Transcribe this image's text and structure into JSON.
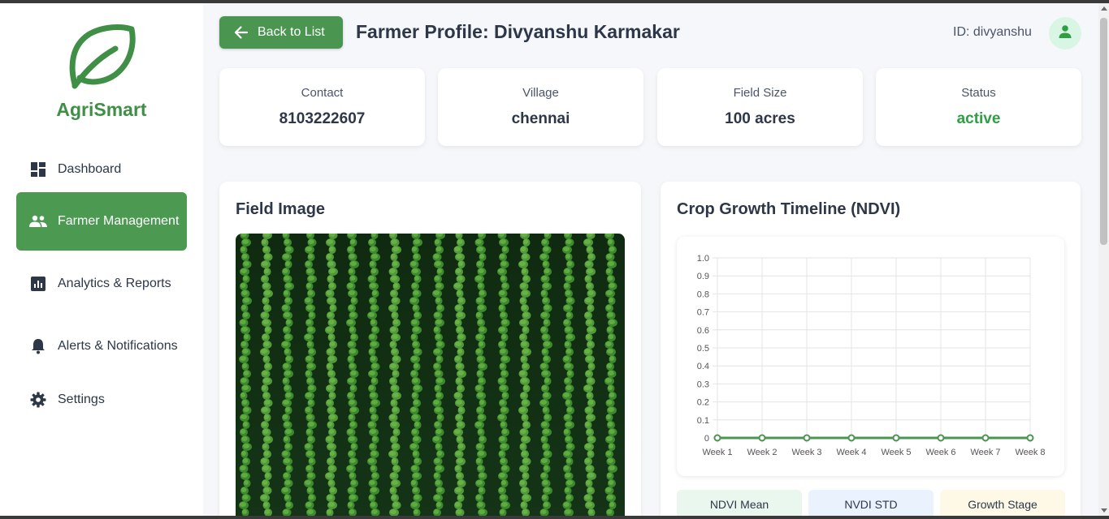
{
  "app": {
    "name": "AgriSmart"
  },
  "sidebar": {
    "items": [
      {
        "label": "Dashboard",
        "icon": "dashboard-icon",
        "active": false
      },
      {
        "label": "Farmer Management",
        "icon": "people-icon",
        "active": true
      },
      {
        "label": "Analytics & Reports",
        "icon": "analytics-icon",
        "active": false
      },
      {
        "label": "Alerts & Notifications",
        "icon": "bell-icon",
        "active": false
      },
      {
        "label": "Settings",
        "icon": "gear-icon",
        "active": false
      }
    ]
  },
  "header": {
    "back_label": "Back to List",
    "title": "Farmer Profile: Divyanshu Karmakar",
    "user_id": "ID: divyanshu"
  },
  "stats": [
    {
      "label": "Contact",
      "value": "8103222607"
    },
    {
      "label": "Village",
      "value": "chennai"
    },
    {
      "label": "Field Size",
      "value": "100 acres"
    },
    {
      "label": "Status",
      "value": "active",
      "color": "#2f9e44"
    }
  ],
  "field_panel": {
    "title": "Field Image"
  },
  "timeline_panel": {
    "title": "Crop Growth Timeline (NDVI)"
  },
  "chart_data": {
    "type": "line",
    "categories": [
      "Week 1",
      "Week 2",
      "Week 3",
      "Week 4",
      "Week 5",
      "Week 6",
      "Week 7",
      "Week 8"
    ],
    "values": [
      0,
      0,
      0,
      0,
      0,
      0,
      0,
      0
    ],
    "ylim": [
      0,
      1.0
    ],
    "yticks": [
      "1.0",
      "0.9",
      "0.8",
      "0.7",
      "0.6",
      "0.5",
      "0.4",
      "0.3",
      "0.2",
      "0.1",
      "0"
    ],
    "grid": true,
    "color": "#4a9550"
  },
  "metrics": [
    {
      "label": "NDVI Mean",
      "bg": "#e9f7ee"
    },
    {
      "label": "NVDI STD",
      "bg": "#eaf2fd"
    },
    {
      "label": "Growth Stage",
      "bg": "#fdf9e6"
    }
  ],
  "colors": {
    "brand": "#3f8f46",
    "active_nav": "#4c9a52",
    "button": "#4a9550"
  }
}
